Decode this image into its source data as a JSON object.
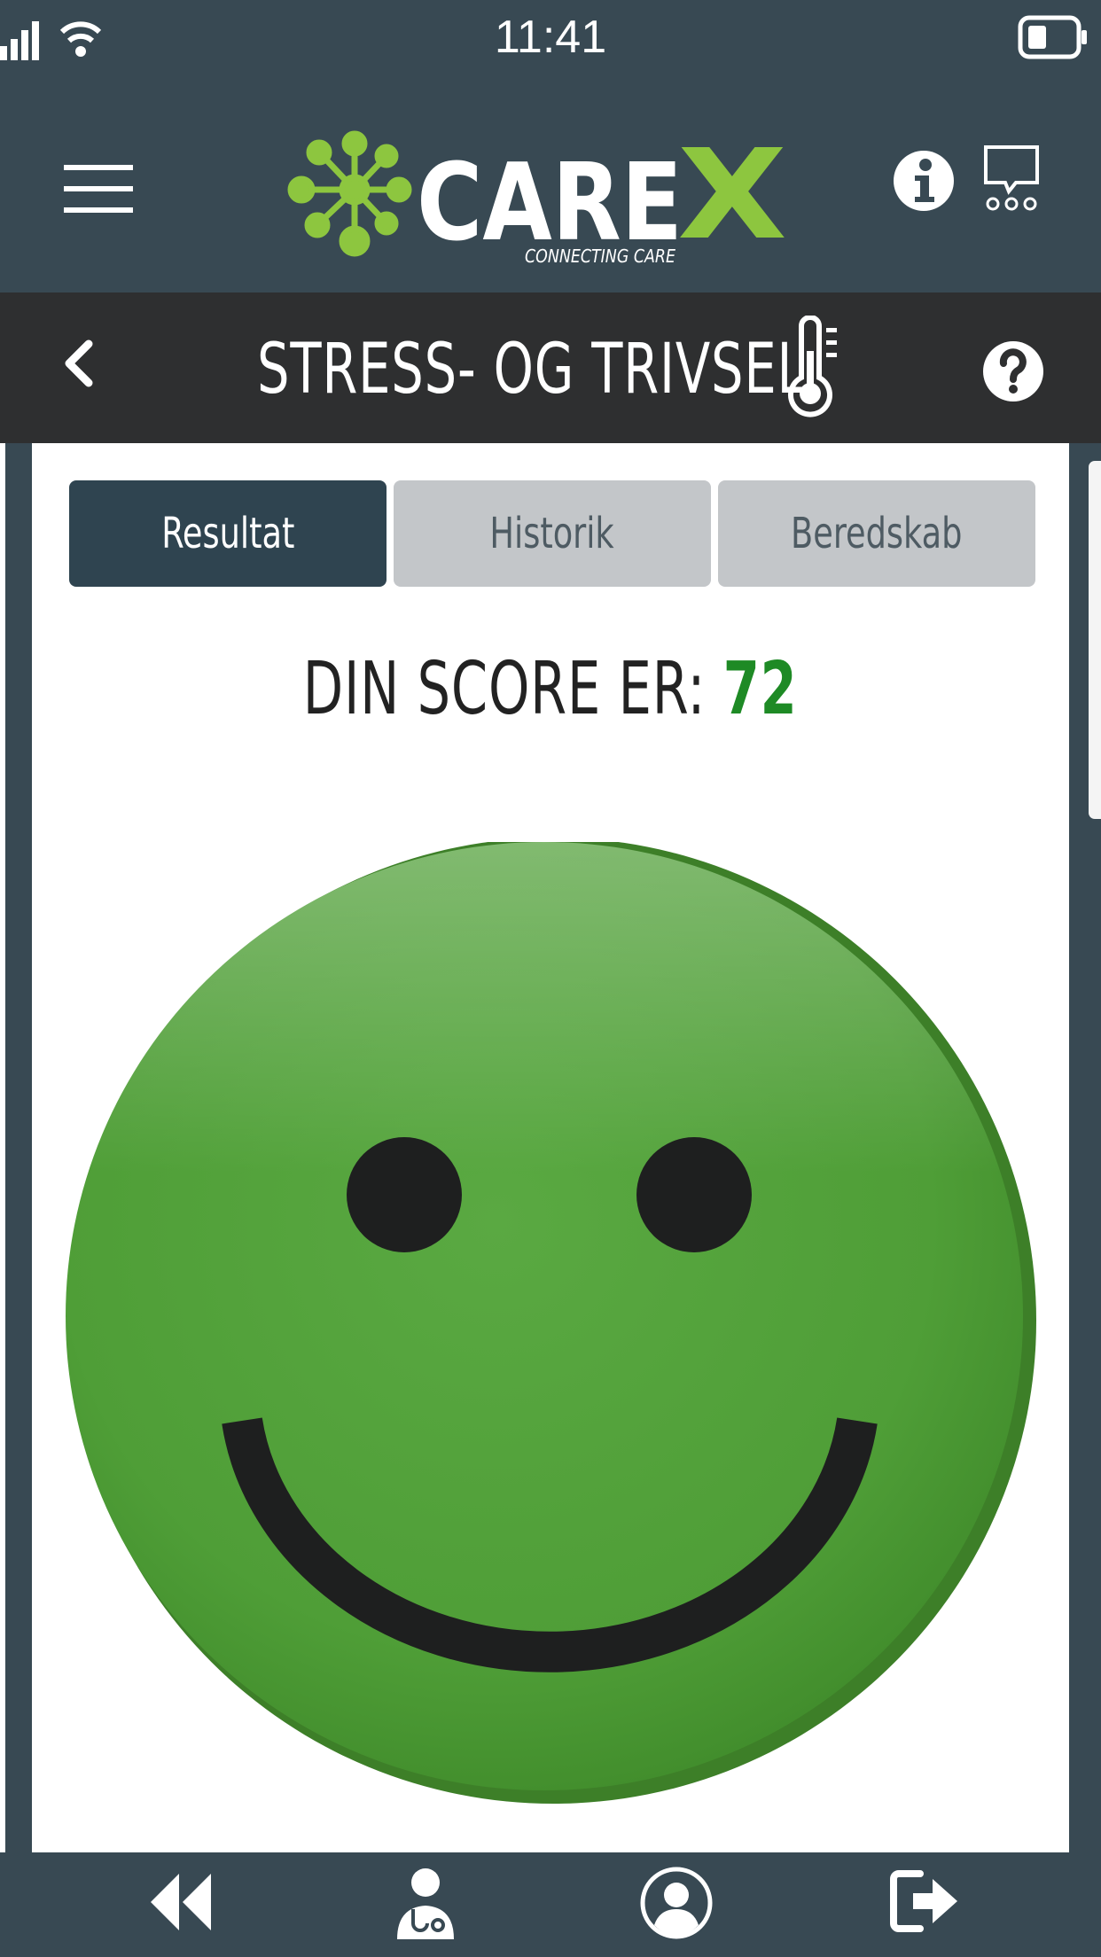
{
  "status_bar": {
    "time": "11:41"
  },
  "header": {
    "logo_text": "CAREX",
    "logo_tagline": "CONNECTING CARE"
  },
  "title_bar": {
    "title": "STRESS- OG TRIVSEL"
  },
  "tabs": [
    {
      "label": "Resultat",
      "active": true
    },
    {
      "label": "Historik",
      "active": false
    },
    {
      "label": "Beredskab",
      "active": false
    }
  ],
  "result": {
    "score_label": "DIN SCORE ER:",
    "score_value": "72",
    "score_color": "#1e8a25",
    "mood": "happy"
  },
  "colors": {
    "header_bg": "#384953",
    "title_bg": "#2e2f30",
    "accent_green": "#8dc63f",
    "active_tab": "#2f4450",
    "inactive_tab": "#c3c6c9"
  },
  "bottom_nav": {
    "icons": [
      "rewind-icon",
      "doctor-icon",
      "profile-icon",
      "logout-icon"
    ]
  }
}
